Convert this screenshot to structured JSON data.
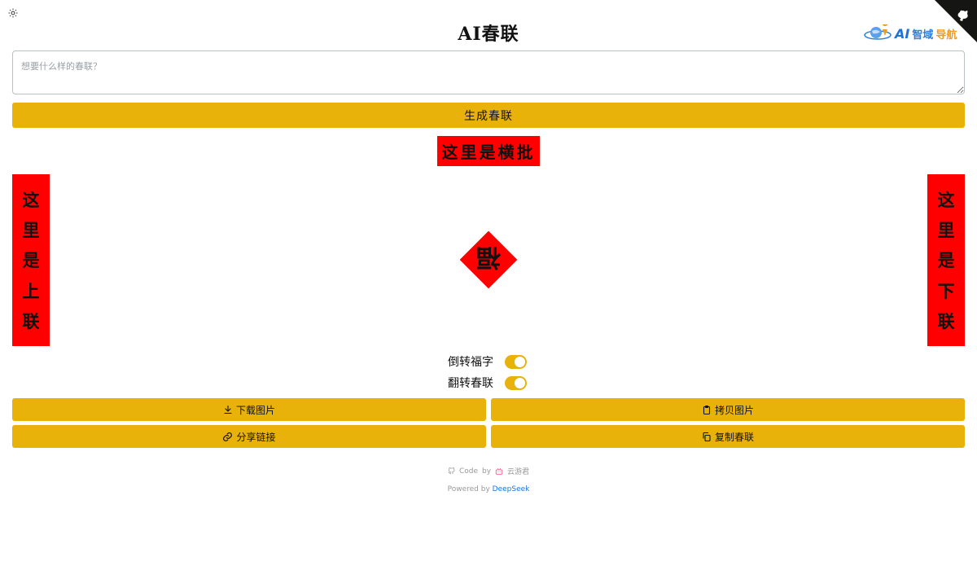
{
  "app": {
    "title": "AI春联"
  },
  "site_logo": {
    "ai": "AI",
    "name_a": "智域",
    "name_b": "导航"
  },
  "prompt": {
    "placeholder": "想要什么样的春联？",
    "value": ""
  },
  "generate_button": {
    "label": "生成春联"
  },
  "couplet": {
    "horizontal": "这里是横批",
    "upper": [
      "这",
      "里",
      "是",
      "上",
      "联"
    ],
    "lower": [
      "这",
      "里",
      "是",
      "下",
      "联"
    ],
    "fu": "福"
  },
  "toggles": {
    "invert_fu": {
      "label": "倒转福字",
      "on": true
    },
    "swap_couplet": {
      "label": "翻转春联",
      "on": true
    }
  },
  "actions": {
    "download": "下载图片",
    "copy_image": "拷贝图片",
    "share": "分享链接",
    "copy_text": "复制春联"
  },
  "footer": {
    "code": "Code",
    "by": "by",
    "author": "云游君",
    "powered": "Powered by",
    "provider": "DeepSeek"
  },
  "colors": {
    "accent": "#e8b20b",
    "paper": "#ff0000",
    "link": "#1a73e8"
  },
  "icons": {
    "theme": "sun-icon",
    "corner": "github-corner-icon",
    "download": "download-icon",
    "copy_image": "clipboard-icon",
    "share": "link-icon",
    "copy_text": "copy-icon"
  }
}
